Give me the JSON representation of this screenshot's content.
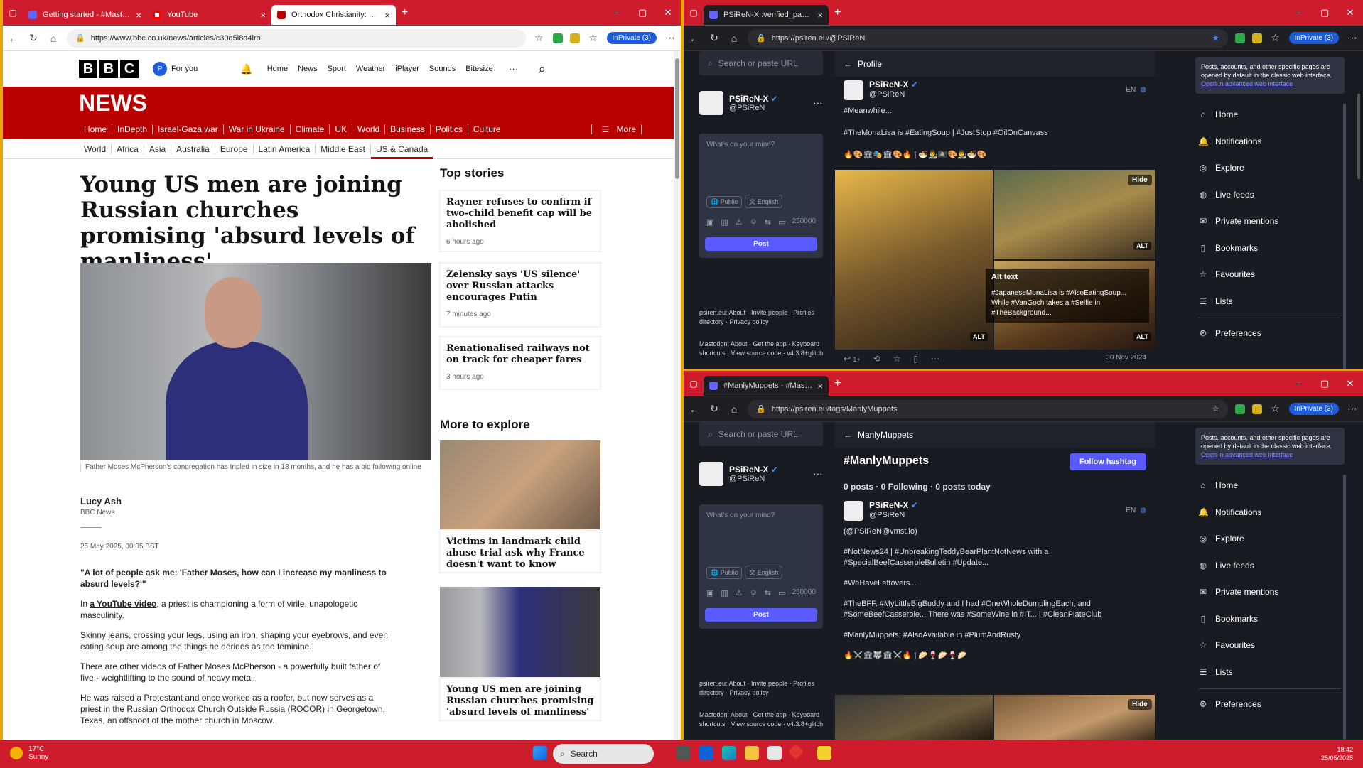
{
  "bbc_window": {
    "tabs": [
      {
        "label": "Getting started - #MastodonSpy"
      },
      {
        "label": "YouTube"
      },
      {
        "label": "Orthodox Christianity: Young US"
      }
    ],
    "url": "https://www.bbc.co.uk/news/articles/c30q5l8d4lro",
    "inprivate": "InPrivate (3)",
    "for_you": "For you",
    "top_nav": [
      "Home",
      "News",
      "Sport",
      "Weather",
      "iPlayer",
      "Sounds",
      "Bitesize"
    ],
    "news_label": "NEWS",
    "red_nav": [
      "Home",
      "InDepth",
      "Israel-Gaza war",
      "War in Ukraine",
      "Climate",
      "UK",
      "World",
      "Business",
      "Politics",
      "Culture"
    ],
    "more": "More",
    "sub_nav": [
      "World",
      "Africa",
      "Asia",
      "Australia",
      "Europe",
      "Latin America",
      "Middle East",
      "US & Canada"
    ],
    "headline": "Young US men are joining Russian churches promising 'absurd levels of manliness'",
    "caption": "Father Moses McPherson's congregation has tripled in size in 18 months, and he has a big following online",
    "author": "Lucy Ash",
    "author_org": "BBC News",
    "date": "25 May 2025, 00:05 BST",
    "para1": "\"A lot of people ask me: 'Father Moses, how can I increase my manliness to absurd levels?'\"",
    "para2_pre": "In ",
    "para2_link": "a YouTube video",
    "para2_post": ", a priest is championing a form of virile, unapologetic masculinity.",
    "para3": "Skinny jeans, crossing your legs, using an iron, shaping your eyebrows, and even eating soup are among the things he derides as too feminine.",
    "para4": "There are other videos of Father Moses McPherson - a powerfully built father of five - weightlifting to the sound of heavy metal.",
    "para5": "He was raised a Protestant and once worked as a roofer, but now serves as a priest in the Russian Orthodox Church Outside Russia (ROCOR) in Georgetown, Texas, an offshoot of the mother church in Moscow.",
    "top_stories_title": "Top stories",
    "top_stories": [
      {
        "title": "Rayner refuses to confirm if two-child benefit cap will be abolished",
        "time": "6 hours ago"
      },
      {
        "title": "Zelensky says 'US silence' over Russian attacks encourages Putin",
        "time": "7 minutes ago"
      },
      {
        "title": "Renationalised railways not on track for cheaper fares",
        "time": "3 hours ago"
      }
    ],
    "explore_title": "More to explore",
    "explore": [
      {
        "title": "Victims in landmark child abuse trial ask why France doesn't want to know"
      },
      {
        "title": "Young US men are joining Russian churches promising 'absurd levels of manliness'"
      }
    ]
  },
  "mast_top": {
    "tab": "PSiReN-X :verified_paw: (@PSiReN",
    "url": "https://psiren.eu/@PSiReN",
    "inprivate": "InPrivate (3)",
    "search_placeholder": "Search or paste URL",
    "name": "PSiReN-X",
    "handle": "@PSiReN",
    "compose_placeholder": "What's on your mind?",
    "public": "Public",
    "english": "English",
    "char_count": "250000",
    "post": "Post",
    "footer1": "psiren.eu: About · Invite people · Profiles directory · Privacy policy",
    "footer2": "Mastodon: About · Get the app · Keyboard shortcuts · View source code · v4.3.8+glitch",
    "col_title": "Profile",
    "post_name": "PSiReN-X",
    "post_handle": "@PSiReN",
    "post_lang": "EN",
    "line1": "#Meanwhile...",
    "line2": "#TheMonaLisa is #EatingSoup | #JustStop #OilOnCanvass",
    "emoji_row": "🔥🎨🏛🎭🏛🎨🔥 | 🍜👨‍🎨🏴‍☠️🎨👨‍🎨🍜🎨",
    "hide": "Hide",
    "alt": "ALT",
    "alt_title": "Alt text",
    "alt_body": "#JapaneseMonaLisa is #AlsoEatingSoup... While #VanGoch takes a #Selfie in #TheBackground...",
    "reply_count": "1+",
    "post_date": "30 Nov 2024",
    "notice": "Posts, accounts, and other specific pages are opened by default in the classic web interface.",
    "notice_link": "Open in advanced web interface",
    "menu": [
      "Home",
      "Notifications",
      "Explore",
      "Live feeds",
      "Private mentions",
      "Bookmarks",
      "Favourites",
      "Lists",
      "Preferences"
    ]
  },
  "mast_bottom": {
    "tab": "#ManlyMuppets - #MastodonSpy",
    "url": "https://psiren.eu/tags/ManlyMuppets",
    "inprivate": "InPrivate (3)",
    "search_placeholder": "Search or paste URL",
    "name": "PSiReN-X",
    "handle": "@PSiReN",
    "compose_placeholder": "What's on your mind?",
    "public": "Public",
    "english": "English",
    "char_count": "250000",
    "post": "Post",
    "footer1": "psiren.eu: About · Invite people · Profiles directory · Privacy policy",
    "footer2": "Mastodon: About · Get the app · Keyboard shortcuts · View source code · v4.3.8+glitch",
    "col_title": "ManlyMuppets",
    "hashtag": "#ManlyMuppets",
    "follow": "Follow hashtag",
    "stats": "0 posts · 0 Following · 0 posts today",
    "post_name": "PSiReN-X",
    "post_handle": "@PSiReN",
    "post_lang": "EN",
    "l1": "(@PSiReN@vmst.io)",
    "l2": "#NotNews24 | #UnbreakingTeddyBearPlantNotNews with a #SpecialBeefCasseroleBulletin #Update...",
    "l3": "#WeHaveLeftovers...",
    "l4": "#TheBFF, #MyLittleBigBuddy and I had #OneWholeDumplingEach, and #SomeBeefCasserole... There was #SomeWine in #IT... | #CleanPlateClub",
    "l5": "#ManlyMuppets; #AlsoAvailable in #PlumAndRusty",
    "emoji_row": "🔥⚔️🏛🐺🏛⚔️🔥 | 🥟🍷🥟🍷🥟",
    "hide": "Hide",
    "notice": "Posts, accounts, and other specific pages are opened by default in the classic web interface.",
    "notice_link": "Open in advanced web interface",
    "menu": [
      "Home",
      "Notifications",
      "Explore",
      "Live feeds",
      "Private mentions",
      "Bookmarks",
      "Favourites",
      "Lists",
      "Preferences"
    ]
  },
  "taskbar": {
    "temp": "17°C",
    "weather": "Sunny",
    "search": "Search",
    "time": "18:42",
    "date": "25/05/2025"
  }
}
